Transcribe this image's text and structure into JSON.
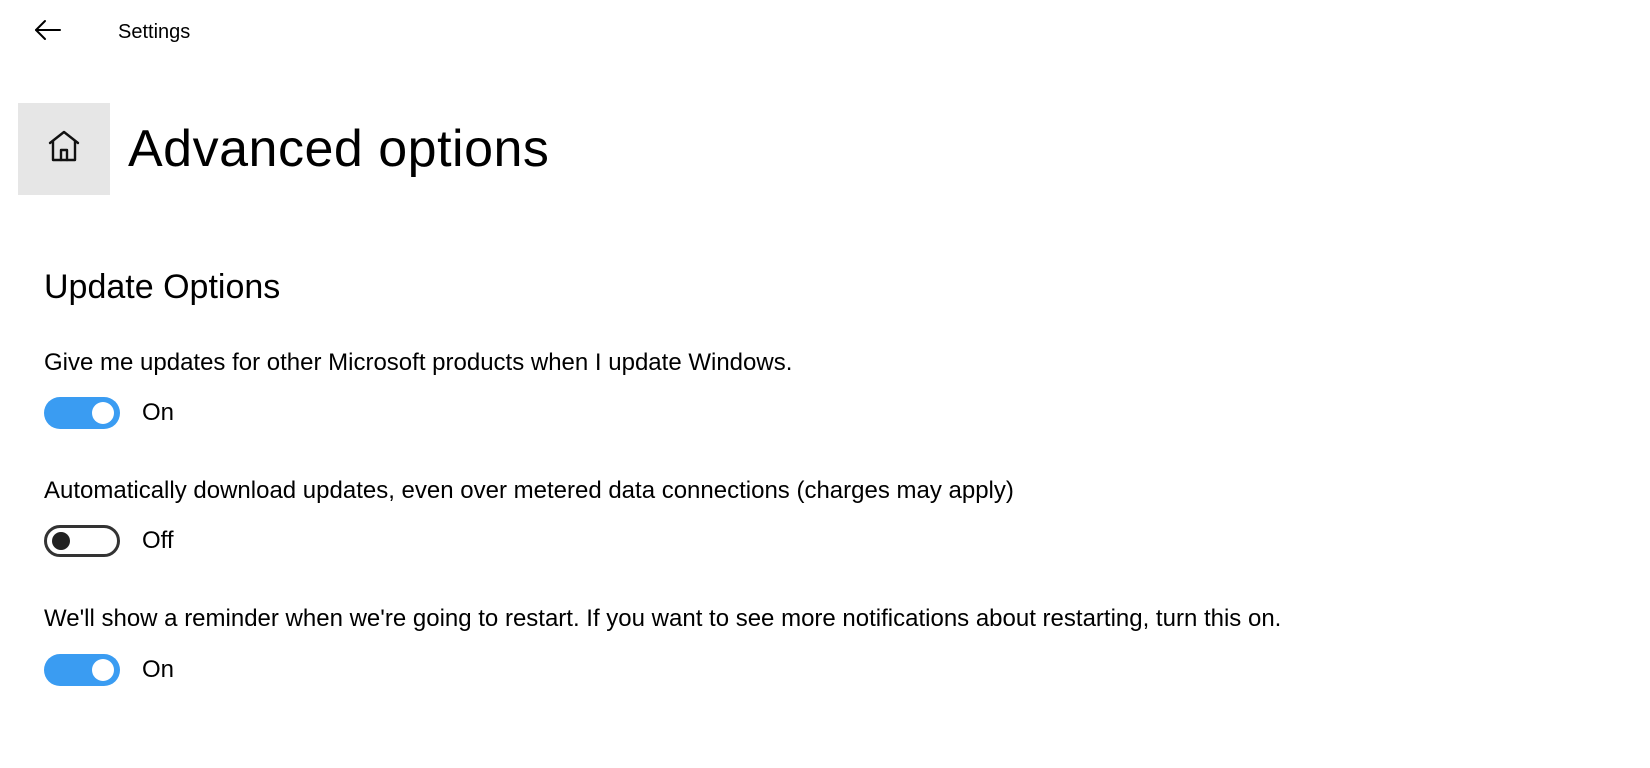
{
  "header": {
    "app_title": "Settings"
  },
  "page": {
    "title": "Advanced options"
  },
  "section": {
    "heading": "Update Options"
  },
  "options": [
    {
      "description": "Give me updates for other Microsoft products when I update Windows.",
      "state": "On",
      "on": true
    },
    {
      "description": "Automatically download updates, even over metered data connections (charges may apply)",
      "state": "Off",
      "on": false
    },
    {
      "description": "We'll show a reminder when we're going to restart. If you want to see more notifications about restarting, turn this on.",
      "state": "On",
      "on": true
    }
  ]
}
